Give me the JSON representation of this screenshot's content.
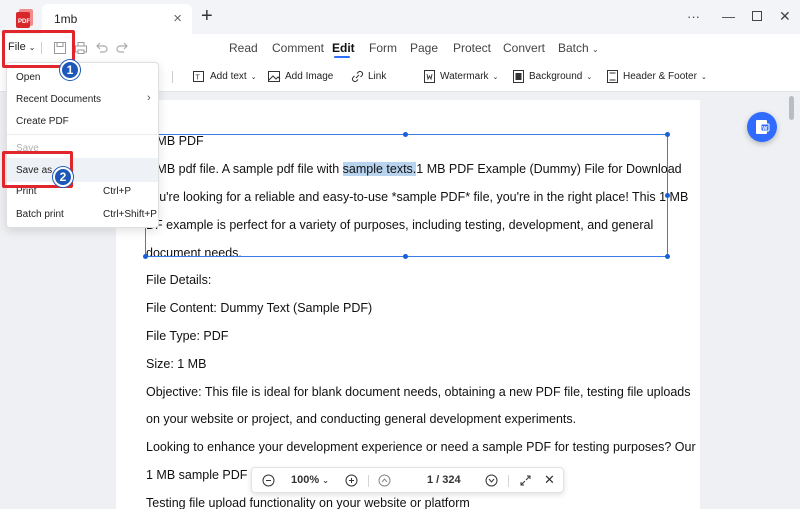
{
  "tab": {
    "title": "1mb"
  },
  "toolbar": {
    "file_label": "File",
    "modes": [
      "Read",
      "Comment",
      "Edit",
      "Form",
      "Page",
      "Protect",
      "Convert",
      "Batch"
    ],
    "edit_tools": [
      "Add text",
      "Add Image",
      "Link",
      "Watermark",
      "Background",
      "Header & Footer"
    ]
  },
  "menu": {
    "open": "Open",
    "recent": "Recent Documents",
    "create": "Create PDF",
    "save": "Save",
    "save_as": "Save as",
    "print": "Print",
    "print_shortcut": "Ctrl+P",
    "batch_print": "Batch print",
    "batch_print_shortcut": "Ctrl+Shift+P"
  },
  "document": {
    "line1": "1 MB PDF",
    "line2_pre": "1 MB pdf file. A sample pdf file with ",
    "line2_hl": "sample texts.",
    "line2_post": "1 MB PDF Example (Dummy) File for Download",
    "line3": "you're looking for a reliable and easy-to-use *sample PDF* file, you're in the right place! This 1 MB",
    "line4": "DF example is perfect for a variety of purposes, including testing, development, and general",
    "line5": "document needs.",
    "line6": "File Details:",
    "line7": "File Content: Dummy Text (Sample PDF)",
    "line8": "File Type: PDF",
    "line9": "Size: 1 MB",
    "line10": "Objective: This file is ideal for blank document needs, obtaining a new PDF file, testing file uploads",
    "line11": "on your website or project, and conducting general development experiments.",
    "line12": "Looking to enhance your development experience or need a sample PDF for testing purposes? Our",
    "line13": "1 MB sample PDF fi",
    "line14": "Testing file upload functionality on your website or platform"
  },
  "zoom": {
    "level": "100%",
    "page": "1 / 324"
  },
  "annotations": {
    "step1": "1",
    "step2": "2"
  },
  "colors": {
    "accent": "#2f6bff",
    "callout_red": "#e0262b",
    "badge_blue": "#1d57b8",
    "selection": "#3a7be8",
    "highlight": "#b7d3ee"
  }
}
